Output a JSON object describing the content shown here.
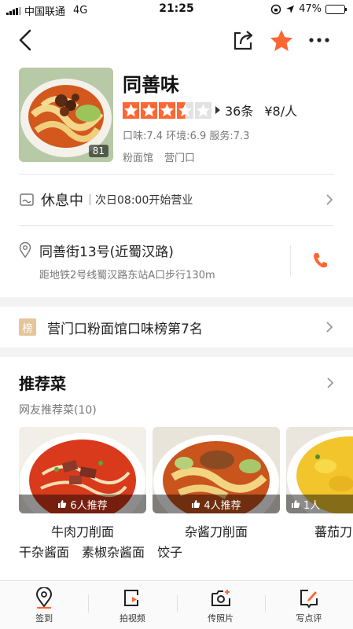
{
  "status_bar": {
    "carrier": "中国联通",
    "network": "4G",
    "time": "21:25",
    "battery": "47%",
    "battery_level": 0.47
  },
  "nav": {
    "back_icon": "back-arrow-icon",
    "share_icon": "share-icon",
    "favorite_icon": "star-icon",
    "more_icon": "more-dots-icon",
    "accent_color": "#ff6633"
  },
  "shop": {
    "name": "同善味",
    "photo_count": "81",
    "rating_stars": 3.5,
    "reviews": "36条",
    "price": "¥8/人",
    "scores": "口味:7.4  环境:6.9  服务:7.3",
    "tags": [
      "粉面馆",
      "营门口"
    ]
  },
  "hours": {
    "status": "休息中",
    "open_time": "次日08:00开始营业"
  },
  "address": {
    "street": "同善街13号(近蜀汉路)",
    "metro": "距地铁2号线蜀汉路东站A口步行130m"
  },
  "rank": {
    "badge": "榜",
    "text": "营门口粉面馆口味榜第7名"
  },
  "recommend": {
    "title": "推荐菜",
    "subtitle": "网友推荐菜(10)",
    "dishes": [
      {
        "name": "牛肉刀削面",
        "recommend": "6人推荐"
      },
      {
        "name": "杂酱刀削面",
        "recommend": "4人推荐"
      },
      {
        "name": "蕃茄刀",
        "recommend": "1人"
      }
    ],
    "more": [
      "干杂酱面",
      "素椒杂酱面",
      "饺子"
    ]
  },
  "tabbar": {
    "items": [
      {
        "label": "签到",
        "icon": "checkin-pin-icon"
      },
      {
        "label": "拍视频",
        "icon": "video-icon"
      },
      {
        "label": "传照片",
        "icon": "camera-icon"
      },
      {
        "label": "写点评",
        "icon": "write-review-icon"
      }
    ]
  }
}
